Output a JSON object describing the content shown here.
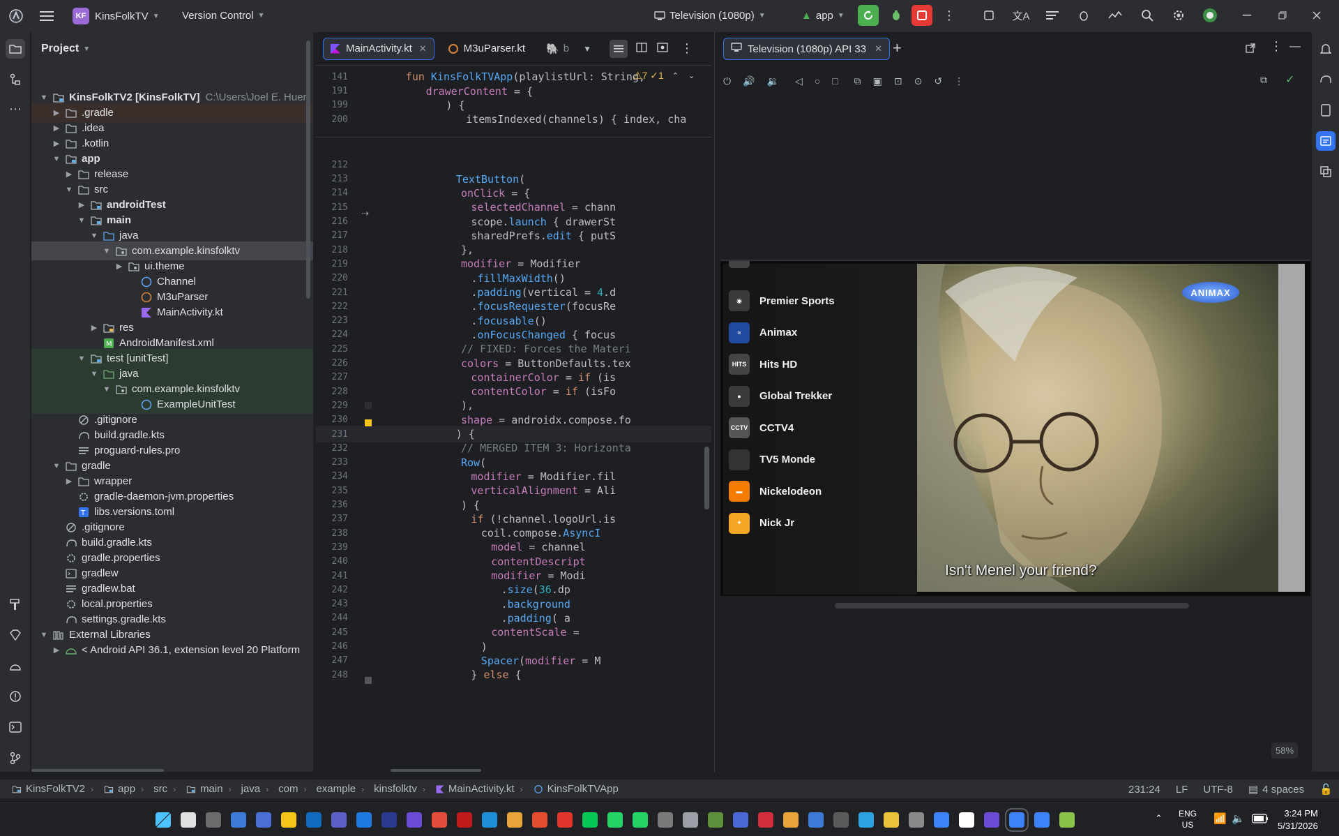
{
  "titlebar": {
    "project_badge": "KF",
    "project_name": "KinsFolkTV",
    "vcs": "Version Control",
    "device": "Television (1080p)",
    "run_config": "app"
  },
  "project_panel": {
    "title": "Project",
    "rows": [
      {
        "label": "KinsFolkTV2 [KinsFolkTV]",
        "extra": "C:\\Users\\Joel E. Huer"
      },
      {
        "label": ".gradle"
      },
      {
        "label": ".idea"
      },
      {
        "label": ".kotlin"
      },
      {
        "label": "app"
      },
      {
        "label": "release"
      },
      {
        "label": "src"
      },
      {
        "label": "androidTest"
      },
      {
        "label": "main"
      },
      {
        "label": "java"
      },
      {
        "label": "com.example.kinsfolktv"
      },
      {
        "label": "ui.theme"
      },
      {
        "label": "Channel"
      },
      {
        "label": "M3uParser"
      },
      {
        "label": "MainActivity.kt"
      },
      {
        "label": "res"
      },
      {
        "label": "AndroidManifest.xml"
      },
      {
        "label": "test [unitTest]"
      },
      {
        "label": "java"
      },
      {
        "label": "com.example.kinsfolktv"
      },
      {
        "label": "ExampleUnitTest"
      },
      {
        "label": ".gitignore"
      },
      {
        "label": "build.gradle.kts"
      },
      {
        "label": "proguard-rules.pro"
      },
      {
        "label": "gradle"
      },
      {
        "label": "wrapper"
      },
      {
        "label": "gradle-daemon-jvm.properties"
      },
      {
        "label": "libs.versions.toml"
      },
      {
        "label": ".gitignore"
      },
      {
        "label": "build.gradle.kts"
      },
      {
        "label": "gradle.properties"
      },
      {
        "label": "gradlew"
      },
      {
        "label": "gradlew.bat"
      },
      {
        "label": "local.properties"
      },
      {
        "label": "settings.gradle.kts"
      },
      {
        "label": "External Libraries"
      },
      {
        "label": "< Android API 36.1, extension level 20 Platform"
      }
    ]
  },
  "editor": {
    "tabs": [
      "MainActivity.kt",
      "M3uParser.kt",
      "b"
    ],
    "sticky": [
      {
        "n": "141",
        "code": "fun KinsFolkTVApp(playlistUrl: String,"
      },
      {
        "n": "191",
        "code": "drawerContent = {"
      },
      {
        "n": "199",
        "code": ") {"
      },
      {
        "n": "200",
        "code": "itemsIndexed(channels) { index, cha"
      }
    ],
    "inspection": "⚠7  ✓1",
    "lines": [
      {
        "n": "212",
        "code": ""
      },
      {
        "n": "213",
        "code": "TextButton("
      },
      {
        "n": "214",
        "code": "onClick = {"
      },
      {
        "n": "215",
        "code": "selectedChannel = chann"
      },
      {
        "n": "216",
        "code": "scope.launch { drawerSt"
      },
      {
        "n": "217",
        "code": "sharedPrefs.edit { putS"
      },
      {
        "n": "218",
        "code": "},"
      },
      {
        "n": "219",
        "code": "modifier = Modifier"
      },
      {
        "n": "220",
        "code": ".fillMaxWidth()"
      },
      {
        "n": "221",
        "code": ".padding(vertical = 4.d"
      },
      {
        "n": "222",
        "code": ".focusRequester(focusRe"
      },
      {
        "n": "223",
        "code": ".focusable()"
      },
      {
        "n": "224",
        "code": ".onFocusChanged { focus"
      },
      {
        "n": "225",
        "code": "// FIXED: Forces the Materi"
      },
      {
        "n": "226",
        "code": "colors = ButtonDefaults.tex"
      },
      {
        "n": "227",
        "code": "containerColor = if (is"
      },
      {
        "n": "228",
        "code": "contentColor = if (isFo"
      },
      {
        "n": "229",
        "code": "),"
      },
      {
        "n": "230",
        "code": "shape = androidx.compose.fo"
      },
      {
        "n": "231",
        "code": ") {"
      },
      {
        "n": "232",
        "code": "// MERGED ITEM 3: Horizonta"
      },
      {
        "n": "233",
        "code": "Row("
      },
      {
        "n": "234",
        "code": "modifier = Modifier.fil"
      },
      {
        "n": "235",
        "code": "verticalAlignment = Ali"
      },
      {
        "n": "236",
        "code": ") {"
      },
      {
        "n": "237",
        "code": "if (!channel.logoUrl.is"
      },
      {
        "n": "238",
        "code": "coil.compose.AsyncI"
      },
      {
        "n": "239",
        "code": "model = channel"
      },
      {
        "n": "240",
        "code": "contentDescript"
      },
      {
        "n": "241",
        "code": "modifier = Modi"
      },
      {
        "n": "242",
        "code": ".size(36.dp"
      },
      {
        "n": "243",
        "code": ".background"
      },
      {
        "n": "244",
        "code": ".padding( a"
      },
      {
        "n": "245",
        "code": "contentScale ="
      },
      {
        "n": "246",
        "code": ")"
      },
      {
        "n": "247",
        "code": "Spacer(modifier = M"
      },
      {
        "n": "248",
        "code": "} else {"
      }
    ]
  },
  "device_panel": {
    "tab": "Television (1080p) API 33",
    "zoom": "58%",
    "subtitle": "Isn't Menel your friend?",
    "watermark": "ANIMAX",
    "channels": [
      {
        "name": "Premier Sports",
        "logo_color": "#3b3b3b"
      },
      {
        "name": "Animax",
        "logo_color": "#1f4aa0"
      },
      {
        "name": "Hits HD",
        "logo_color": "#444444"
      },
      {
        "name": "Global Trekker",
        "logo_color": "#3a3a3a"
      },
      {
        "name": "CCTV4",
        "logo_color": "#555555"
      },
      {
        "name": "TV5 Monde",
        "logo_color": "#333333"
      },
      {
        "name": "Nickelodeon",
        "logo_color": "#f57c00"
      },
      {
        "name": "Nick Jr",
        "logo_color": "#f5a623"
      }
    ]
  },
  "statusbar": {
    "crumbs": [
      "KinsFolkTV2",
      "app",
      "src",
      "main",
      "java",
      "com",
      "example",
      "kinsfolktv",
      "MainActivity.kt",
      "KinsFolkTVApp"
    ],
    "position": "231:24",
    "line_sep": "LF",
    "encoding": "UTF-8",
    "indent": "4 spaces"
  },
  "taskbar": {
    "lang": "ENG",
    "region": "US",
    "time": "3:24 PM",
    "date": "5/31/2026"
  },
  "colors": {
    "accent": "#3574f0",
    "run_green": "#4caf50",
    "stop_red": "#e53935"
  }
}
